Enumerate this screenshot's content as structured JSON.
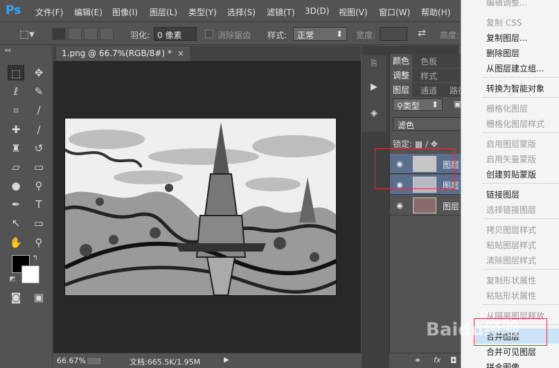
{
  "app": {
    "logo": "Ps"
  },
  "menu": {
    "items": [
      "文件(F)",
      "编辑(E)",
      "图像(I)",
      "图层(L)",
      "类型(Y)",
      "选择(S)",
      "滤镜(T)",
      "3D(D)",
      "视图(V)",
      "窗口(W)",
      "帮助(H)"
    ]
  },
  "options": {
    "feather_label": "羽化:",
    "feather_value": "0 像素",
    "antialias_label": "消除锯齿",
    "style_label": "样式:",
    "style_value": "正常",
    "width_label": "宽度:",
    "height_label": "高度:"
  },
  "document": {
    "tab_title": "1.png @ 66.7%(RGB/8#) *",
    "close": "×",
    "zoom": "66.67%",
    "doc_info": "文档:665.5K/1.95M"
  },
  "panels": {
    "tabs_row1": [
      "颜色",
      "色板"
    ],
    "tabs_row2": [
      "调整",
      "样式"
    ],
    "tabs_row3": [
      "图层",
      "通道",
      "路径"
    ],
    "kind_filter": "类型",
    "blend_mode": "滤色",
    "lock_label": "锁定:",
    "layers": [
      {
        "name": "图层",
        "selected": true
      },
      {
        "name": "图层",
        "selected": true
      },
      {
        "name": "图层",
        "selected": false
      }
    ]
  },
  "context_menu": {
    "items": [
      {
        "label": "编辑调整...",
        "enabled": false
      },
      {
        "label": "复制 CSS",
        "enabled": false
      },
      {
        "label": "复制图层...",
        "enabled": true
      },
      {
        "label": "删除图层",
        "enabled": true
      },
      {
        "label": "从图层建立组...",
        "enabled": true
      },
      {
        "label": "转换为智能对象",
        "enabled": true
      },
      {
        "label": "栅格化图层",
        "enabled": false
      },
      {
        "label": "栅格化图层样式",
        "enabled": false
      },
      {
        "label": "启用图层蒙版",
        "enabled": false
      },
      {
        "label": "启用矢量蒙版",
        "enabled": false
      },
      {
        "label": "创建剪贴蒙版",
        "enabled": true
      },
      {
        "label": "链接图层",
        "enabled": true
      },
      {
        "label": "选择链接图层",
        "enabled": false
      },
      {
        "label": "拷贝图层样式",
        "enabled": false
      },
      {
        "label": "粘贴图层样式",
        "enabled": false
      },
      {
        "label": "清除图层样式",
        "enabled": false
      },
      {
        "label": "复制形状属性",
        "enabled": false
      },
      {
        "label": "粘贴形状属性",
        "enabled": false
      },
      {
        "label": "从隔离图层释放",
        "enabled": false
      },
      {
        "label": "合并图层",
        "enabled": true
      },
      {
        "label": "合并可见图层",
        "enabled": true
      },
      {
        "label": "拼合图像",
        "enabled": true
      }
    ]
  },
  "watermark": "Baidu经验",
  "colors": {
    "highlight": "#cce3f7",
    "annotation": "#e03131",
    "layer_selected": "#5a6f8e",
    "ps_blue": "#31a8ff"
  }
}
